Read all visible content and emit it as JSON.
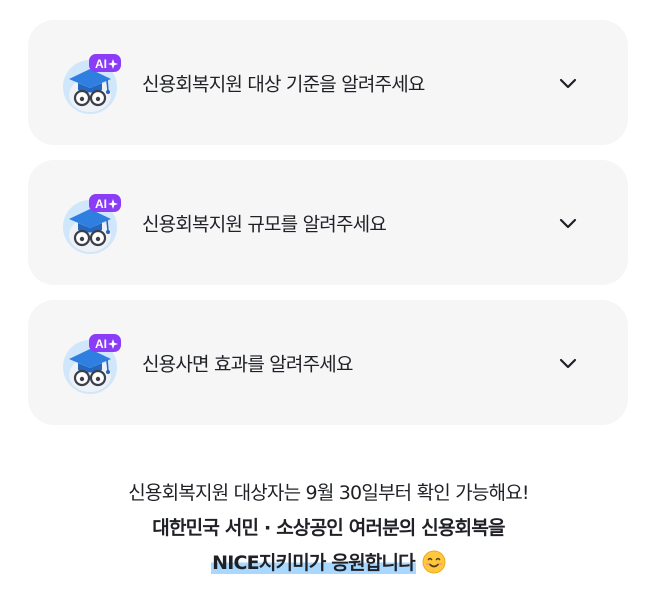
{
  "faq": {
    "items": [
      {
        "question": "신용회복지원 대상 기준을 알려주세요",
        "badge": "AI",
        "icon": "ai-graduate-avatar-icon"
      },
      {
        "question": "신용회복지원 규모를 알려주세요",
        "badge": "AI",
        "icon": "ai-graduate-avatar-icon"
      },
      {
        "question": "신용사면 효과를 알려주세요",
        "badge": "AI",
        "icon": "ai-graduate-avatar-icon"
      }
    ]
  },
  "footer": {
    "line1": "신용회복지원 대상자는 9월 30일부터 확인 가능해요!",
    "line2": "대한민국 서민 · 소상공인 여러분의 신용회복을",
    "line3": "NICE지키미가 응원합니다",
    "emoji": "smiling-face-icon"
  },
  "colors": {
    "card_bg": "#f6f6f7",
    "badge": "#8b3cf7",
    "highlight": "#a8d8ff",
    "text": "#1f2126"
  }
}
